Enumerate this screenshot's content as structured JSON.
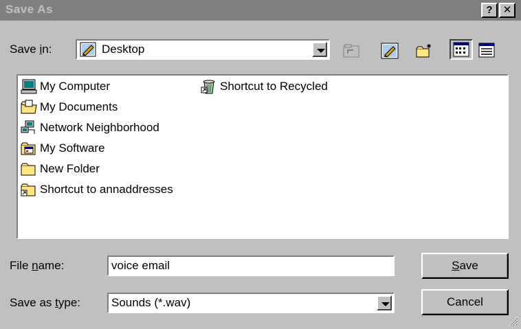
{
  "window": {
    "title": "Save As",
    "help_label": "?",
    "close_label": "✕"
  },
  "save_in": {
    "label_pre": "Save ",
    "label_mn": "i",
    "label_post": "n:",
    "value": "Desktop",
    "icon": "desktop-icon"
  },
  "toolbar": {
    "icons": [
      "up-one-level-icon",
      "desktop-icon",
      "create-new-folder-icon",
      "list-view-icon",
      "details-view-icon"
    ]
  },
  "files": [
    {
      "name": "My Computer",
      "icon": "my-computer-icon"
    },
    {
      "name": "My Documents",
      "icon": "my-documents-icon"
    },
    {
      "name": "Network Neighborhood",
      "icon": "network-neighborhood-icon"
    },
    {
      "name": "My Software",
      "icon": "my-software-icon"
    },
    {
      "name": "New Folder",
      "icon": "folder-icon"
    },
    {
      "name": "Shortcut to annaddresses",
      "icon": "folder-shortcut-icon"
    },
    {
      "name": "Shortcut to Recycled",
      "icon": "recycle-bin-shortcut-icon"
    }
  ],
  "file_name": {
    "label_pre": "File ",
    "label_mn": "n",
    "label_post": "ame:",
    "value": "voice email"
  },
  "save_type": {
    "label_pre": "Save as ",
    "label_mn": "t",
    "label_post": "ype:",
    "value": "Sounds (*.wav)"
  },
  "buttons": {
    "save_mn": "S",
    "save_rest": "ave",
    "cancel": "Cancel"
  }
}
